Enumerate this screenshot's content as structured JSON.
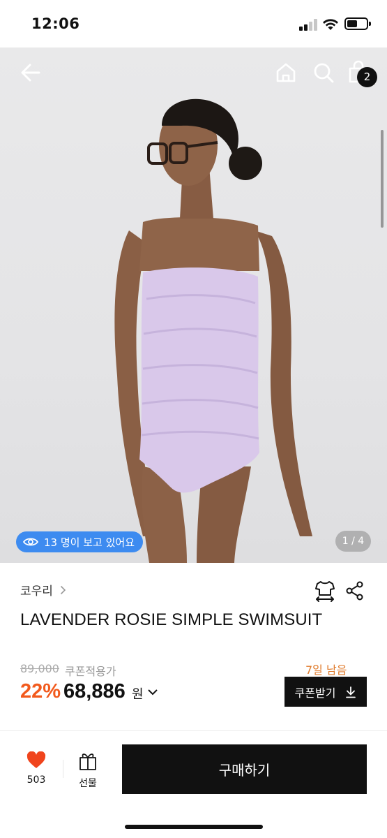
{
  "status_bar": {
    "time": "12:06"
  },
  "gallery": {
    "cart_count": "2",
    "viewers_text": "13 명이 보고 있어요",
    "image_counter": "1 / 4"
  },
  "product": {
    "brand": "코우리",
    "title": "LAVENDER ROSIE SIMPLE SWIMSUIT",
    "original_price": "89,000",
    "coupon_applied_label": "쿠폰적용가",
    "discount": "22%",
    "price": "68,886",
    "price_unit": "원",
    "days_left": "7일 남음",
    "coupon_button": "쿠폰받기"
  },
  "bottom_bar": {
    "like_count": "503",
    "gift_label": "선물",
    "buy_label": "구매하기"
  },
  "colors": {
    "accent_discount": "#f25a1d",
    "days_left": "#e07b2c",
    "viewers_pill": "#3d8bf0",
    "like_heart": "#f0441c",
    "swimsuit": "#d9c8ea"
  },
  "icons": [
    "back-arrow-icon",
    "home-icon",
    "search-icon",
    "cart-icon",
    "eye-icon",
    "chevron-right-icon",
    "size-guide-icon",
    "share-icon",
    "chevron-down-icon",
    "download-icon",
    "heart-icon",
    "gift-icon"
  ]
}
